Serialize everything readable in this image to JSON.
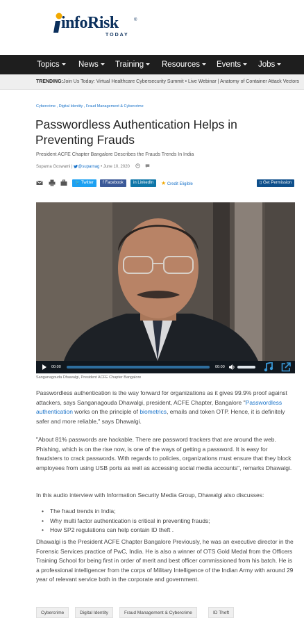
{
  "site": {
    "logo_text": "infoRisk",
    "logo_sub": "TODAY"
  },
  "nav": {
    "items": [
      "Topics",
      "News",
      "Training",
      "Resources",
      "Events",
      "Jobs"
    ]
  },
  "trending": {
    "label": "TRENDING:",
    "text": "Join Us Today: Virtual Healthcare Cybersecurity Summit  •  Live Webinar | Anatomy of Container Attack Vectors"
  },
  "article": {
    "categories": "Cybercrime , Digital Identity , Fraud Management & Cybercrime",
    "title": "Passwordless Authentication Helps in Preventing Frauds",
    "subtitle": "President ACFE Chapter Bangalore Describes the Frauds Trends In India",
    "author": "Suparna Goswami",
    "handle": "@suparnag",
    "date": "June 10, 2020"
  },
  "share": {
    "twitter": "Twitter",
    "facebook": "Facebook",
    "linkedin": "LinkedIn",
    "credit": "Credit Eligible",
    "permission": "Get Permission"
  },
  "player": {
    "current_time": "00:00",
    "duration": "00:00"
  },
  "caption": "Sanganagouda Dhawalgi, President ACFE Chapter Bangalore",
  "body": {
    "p1_a": "Passwordless authentication is the way forward for organizations as it gives 99.9% proof against attackers, says Sanganagouda Dhawalgi, president, ACFE Chapter, Bangalore \"",
    "p1_link1": "Passwordless authentication",
    "p1_b": " works on the principle of ",
    "p1_link2": "biometrics",
    "p1_c": ", emails and token OTP. Hence, it is definitely safer and more reliable,\" says Dhawalgi.",
    "p2": "\"About 81% passwords are hackable. There are password trackers that are around the web. Phishing, which is on the rise now, is one of the ways of getting a password. It is easy for fraudsters to crack passwords. With regards to policies, organizations must ensure that they block employees from using USB ports as well as accessing social media accounts\", remarks Dhawalgi.",
    "p3": "In this audio interview with Information Security Media Group, Dhawalgi also discusses:",
    "bullets": [
      "The fraud trends in India;",
      "Why multi factor authentication is critical in preventing frauds;",
      "How SP2 regulations can help contain ID theft ."
    ],
    "p4": "Dhawalgi is the President ACFE Chapter Bangalore Previously, he was an executive director in the Forensic Services practice of PwC, India. He is also a winner of    OTS    Gold Medal from the Officers Training School for being first in order of merit and best officer commissioned from his batch. He is a professional intelligencer from the corps of Military Intelligence of the Indian Army with around  29 year of relevant service  both in the corporate and government."
  },
  "tags": [
    "Cybercrime",
    "Digital Identity",
    "Fraud Management & Cybercrime",
    "ID Theft"
  ],
  "colors": {
    "nav_bg": "#1e1e1e",
    "link": "#1a73c9",
    "brand_navy": "#0a2f5c",
    "brand_gold": "#f2a900"
  }
}
